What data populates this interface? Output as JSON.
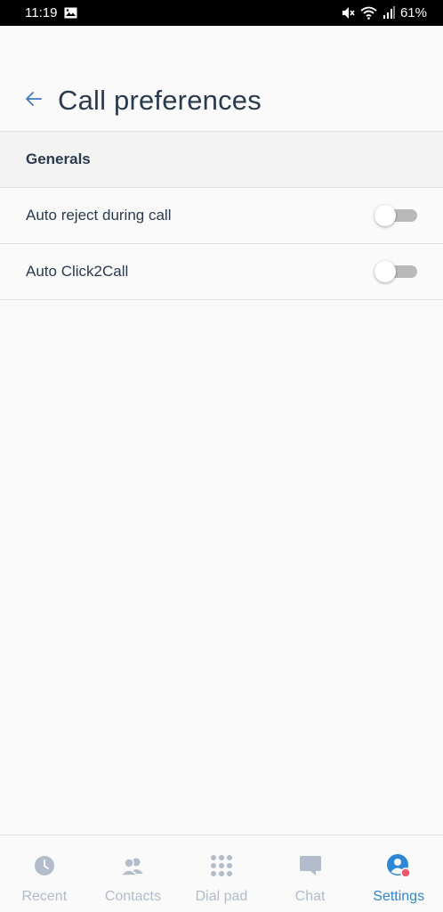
{
  "status_bar": {
    "time": "11:19",
    "battery": "61%",
    "icons": [
      "image-icon",
      "mute-icon",
      "wifi-icon",
      "signal-icon"
    ]
  },
  "header": {
    "back_icon": "arrow-left-icon",
    "title": "Call preferences"
  },
  "section": {
    "title": "Generals"
  },
  "settings": [
    {
      "label": "Auto reject during call",
      "enabled": false
    },
    {
      "label": "Auto Click2Call",
      "enabled": false
    }
  ],
  "bottom_nav": {
    "items": [
      {
        "label": "Recent",
        "icon": "clock-icon",
        "active": false
      },
      {
        "label": "Contacts",
        "icon": "contacts-icon",
        "active": false
      },
      {
        "label": "Dial pad",
        "icon": "dialpad-icon",
        "active": false
      },
      {
        "label": "Chat",
        "icon": "chat-icon",
        "active": false
      },
      {
        "label": "Settings",
        "icon": "settings-user-icon",
        "active": true
      }
    ]
  },
  "colors": {
    "accent": "#2e86d6",
    "inactive": "#b3bccb",
    "badge": "#ef5a6f",
    "toggle_track": "#b9b9b9"
  }
}
